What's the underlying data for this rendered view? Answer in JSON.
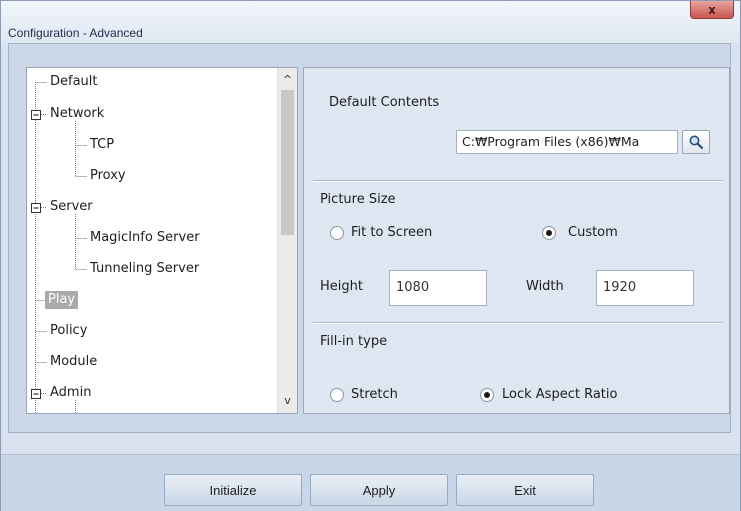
{
  "window": {
    "title": "Configuration - Advanced",
    "close_glyph": "x"
  },
  "tree": {
    "items": [
      {
        "label": "Default",
        "expander": ""
      },
      {
        "label": "Network",
        "expander": "-"
      },
      {
        "label": "TCP",
        "expander": ""
      },
      {
        "label": "Proxy",
        "expander": ""
      },
      {
        "label": "Server",
        "expander": "-"
      },
      {
        "label": "MagicInfo Server",
        "expander": ""
      },
      {
        "label": "Tunneling Server",
        "expander": ""
      },
      {
        "label": "Play",
        "expander": "",
        "selected": true
      },
      {
        "label": "Policy",
        "expander": ""
      },
      {
        "label": "Module",
        "expander": ""
      },
      {
        "label": "Admin",
        "expander": "-"
      }
    ],
    "scroll_up": "^",
    "scroll_down": "v"
  },
  "default_contents": {
    "label": "Default Contents",
    "path_value": "C:₩Program Files (x86)₩Ma",
    "browse_icon": "search-icon"
  },
  "picture_size": {
    "label": "Picture Size",
    "options": [
      {
        "label": "Fit to Screen",
        "checked": false
      },
      {
        "label": "Custom",
        "checked": true
      }
    ],
    "height_label": "Height",
    "height_value": "1080",
    "width_label": "Width",
    "width_value": "1920"
  },
  "fill_in_type": {
    "label": "Fill-in type",
    "options": [
      {
        "label": "Stretch",
        "checked": false
      },
      {
        "label": "Lock Aspect Ratio",
        "checked": true
      }
    ]
  },
  "buttons": {
    "initialize": "Initialize",
    "apply": "Apply",
    "exit": "Exit"
  },
  "colors": {
    "window_bg": "#d9e2ee",
    "panel_bg": "#dde6f1",
    "selected_bg": "#a9a9a9",
    "close_red": "#c9574f"
  }
}
